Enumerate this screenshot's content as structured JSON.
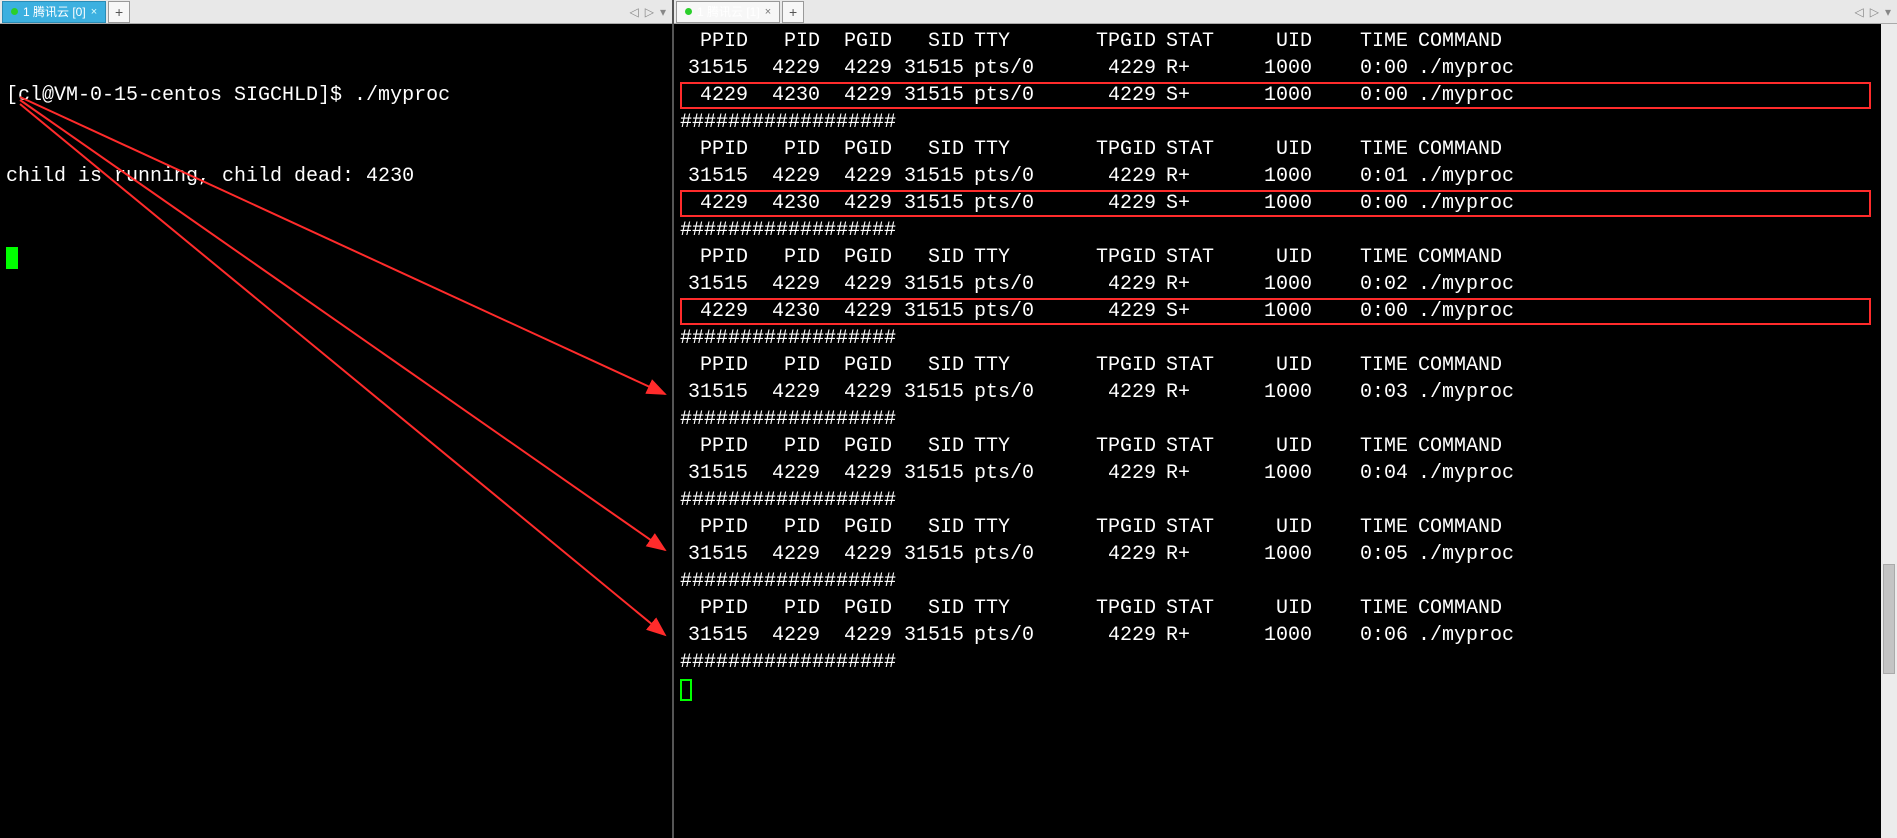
{
  "tabs": {
    "left": {
      "label": "1 腾讯云 [0]"
    },
    "right": {
      "label": "1 腾讯云 [1]"
    }
  },
  "left_term": {
    "prompt": "[cl@VM-0-15-centos SIGCHLD]$ ./myproc",
    "line2": "child is running, child dead: 4230"
  },
  "header_labels": {
    "ppid": "PPID",
    "pid": "PID",
    "pgid": "PGID",
    "sid": "SID",
    "tty": "TTY",
    "tpgid": "TPGID",
    "stat": "STAT",
    "uid": "UID",
    "time": "TIME",
    "cmd": "COMMAND"
  },
  "separator": "##################",
  "blocks": [
    {
      "rows": [
        {
          "ppid": "31515",
          "pid": "4229",
          "pgid": "4229",
          "sid": "31515",
          "tty": "pts/0",
          "tpgid": "4229",
          "stat": "R+",
          "uid": "1000",
          "time": "0:00",
          "cmd": "./myproc"
        },
        {
          "ppid": "4229",
          "pid": "4230",
          "pgid": "4229",
          "sid": "31515",
          "tty": "pts/0",
          "tpgid": "4229",
          "stat": "S+",
          "uid": "1000",
          "time": "0:00",
          "cmd": "./myproc",
          "highlight": true
        }
      ]
    },
    {
      "rows": [
        {
          "ppid": "31515",
          "pid": "4229",
          "pgid": "4229",
          "sid": "31515",
          "tty": "pts/0",
          "tpgid": "4229",
          "stat": "R+",
          "uid": "1000",
          "time": "0:01",
          "cmd": "./myproc"
        },
        {
          "ppid": "4229",
          "pid": "4230",
          "pgid": "4229",
          "sid": "31515",
          "tty": "pts/0",
          "tpgid": "4229",
          "stat": "S+",
          "uid": "1000",
          "time": "0:00",
          "cmd": "./myproc",
          "highlight": true
        }
      ]
    },
    {
      "rows": [
        {
          "ppid": "31515",
          "pid": "4229",
          "pgid": "4229",
          "sid": "31515",
          "tty": "pts/0",
          "tpgid": "4229",
          "stat": "R+",
          "uid": "1000",
          "time": "0:02",
          "cmd": "./myproc"
        },
        {
          "ppid": "4229",
          "pid": "4230",
          "pgid": "4229",
          "sid": "31515",
          "tty": "pts/0",
          "tpgid": "4229",
          "stat": "S+",
          "uid": "1000",
          "time": "0:00",
          "cmd": "./myproc",
          "highlight": true
        }
      ]
    },
    {
      "rows": [
        {
          "ppid": "31515",
          "pid": "4229",
          "pgid": "4229",
          "sid": "31515",
          "tty": "pts/0",
          "tpgid": "4229",
          "stat": "R+",
          "uid": "1000",
          "time": "0:03",
          "cmd": "./myproc"
        }
      ]
    },
    {
      "rows": [
        {
          "ppid": "31515",
          "pid": "4229",
          "pgid": "4229",
          "sid": "31515",
          "tty": "pts/0",
          "tpgid": "4229",
          "stat": "R+",
          "uid": "1000",
          "time": "0:04",
          "cmd": "./myproc"
        }
      ]
    },
    {
      "rows": [
        {
          "ppid": "31515",
          "pid": "4229",
          "pgid": "4229",
          "sid": "31515",
          "tty": "pts/0",
          "tpgid": "4229",
          "stat": "R+",
          "uid": "1000",
          "time": "0:05",
          "cmd": "./myproc"
        }
      ]
    },
    {
      "rows": [
        {
          "ppid": "31515",
          "pid": "4229",
          "pgid": "4229",
          "sid": "31515",
          "tty": "pts/0",
          "tpgid": "4229",
          "stat": "R+",
          "uid": "1000",
          "time": "0:06",
          "cmd": "./myproc"
        }
      ]
    }
  ]
}
